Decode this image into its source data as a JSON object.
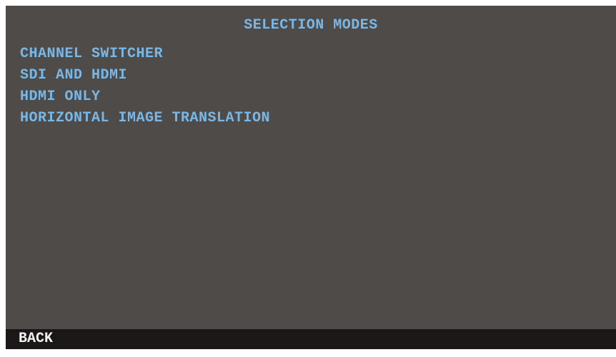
{
  "screen": {
    "title": "SELECTION MODES",
    "menu_items": [
      {
        "label": "CHANNEL SWITCHER"
      },
      {
        "label": "SDI AND HDMI"
      },
      {
        "label": "HDMI ONLY"
      },
      {
        "label": "HORIZONTAL IMAGE TRANSLATION"
      }
    ]
  },
  "footer": {
    "back_label": "BACK"
  },
  "colors": {
    "background": "#4f4b49",
    "menu_text": "#78b8e8",
    "footer_background": "#1a1716",
    "footer_text": "#f2f2f2"
  }
}
